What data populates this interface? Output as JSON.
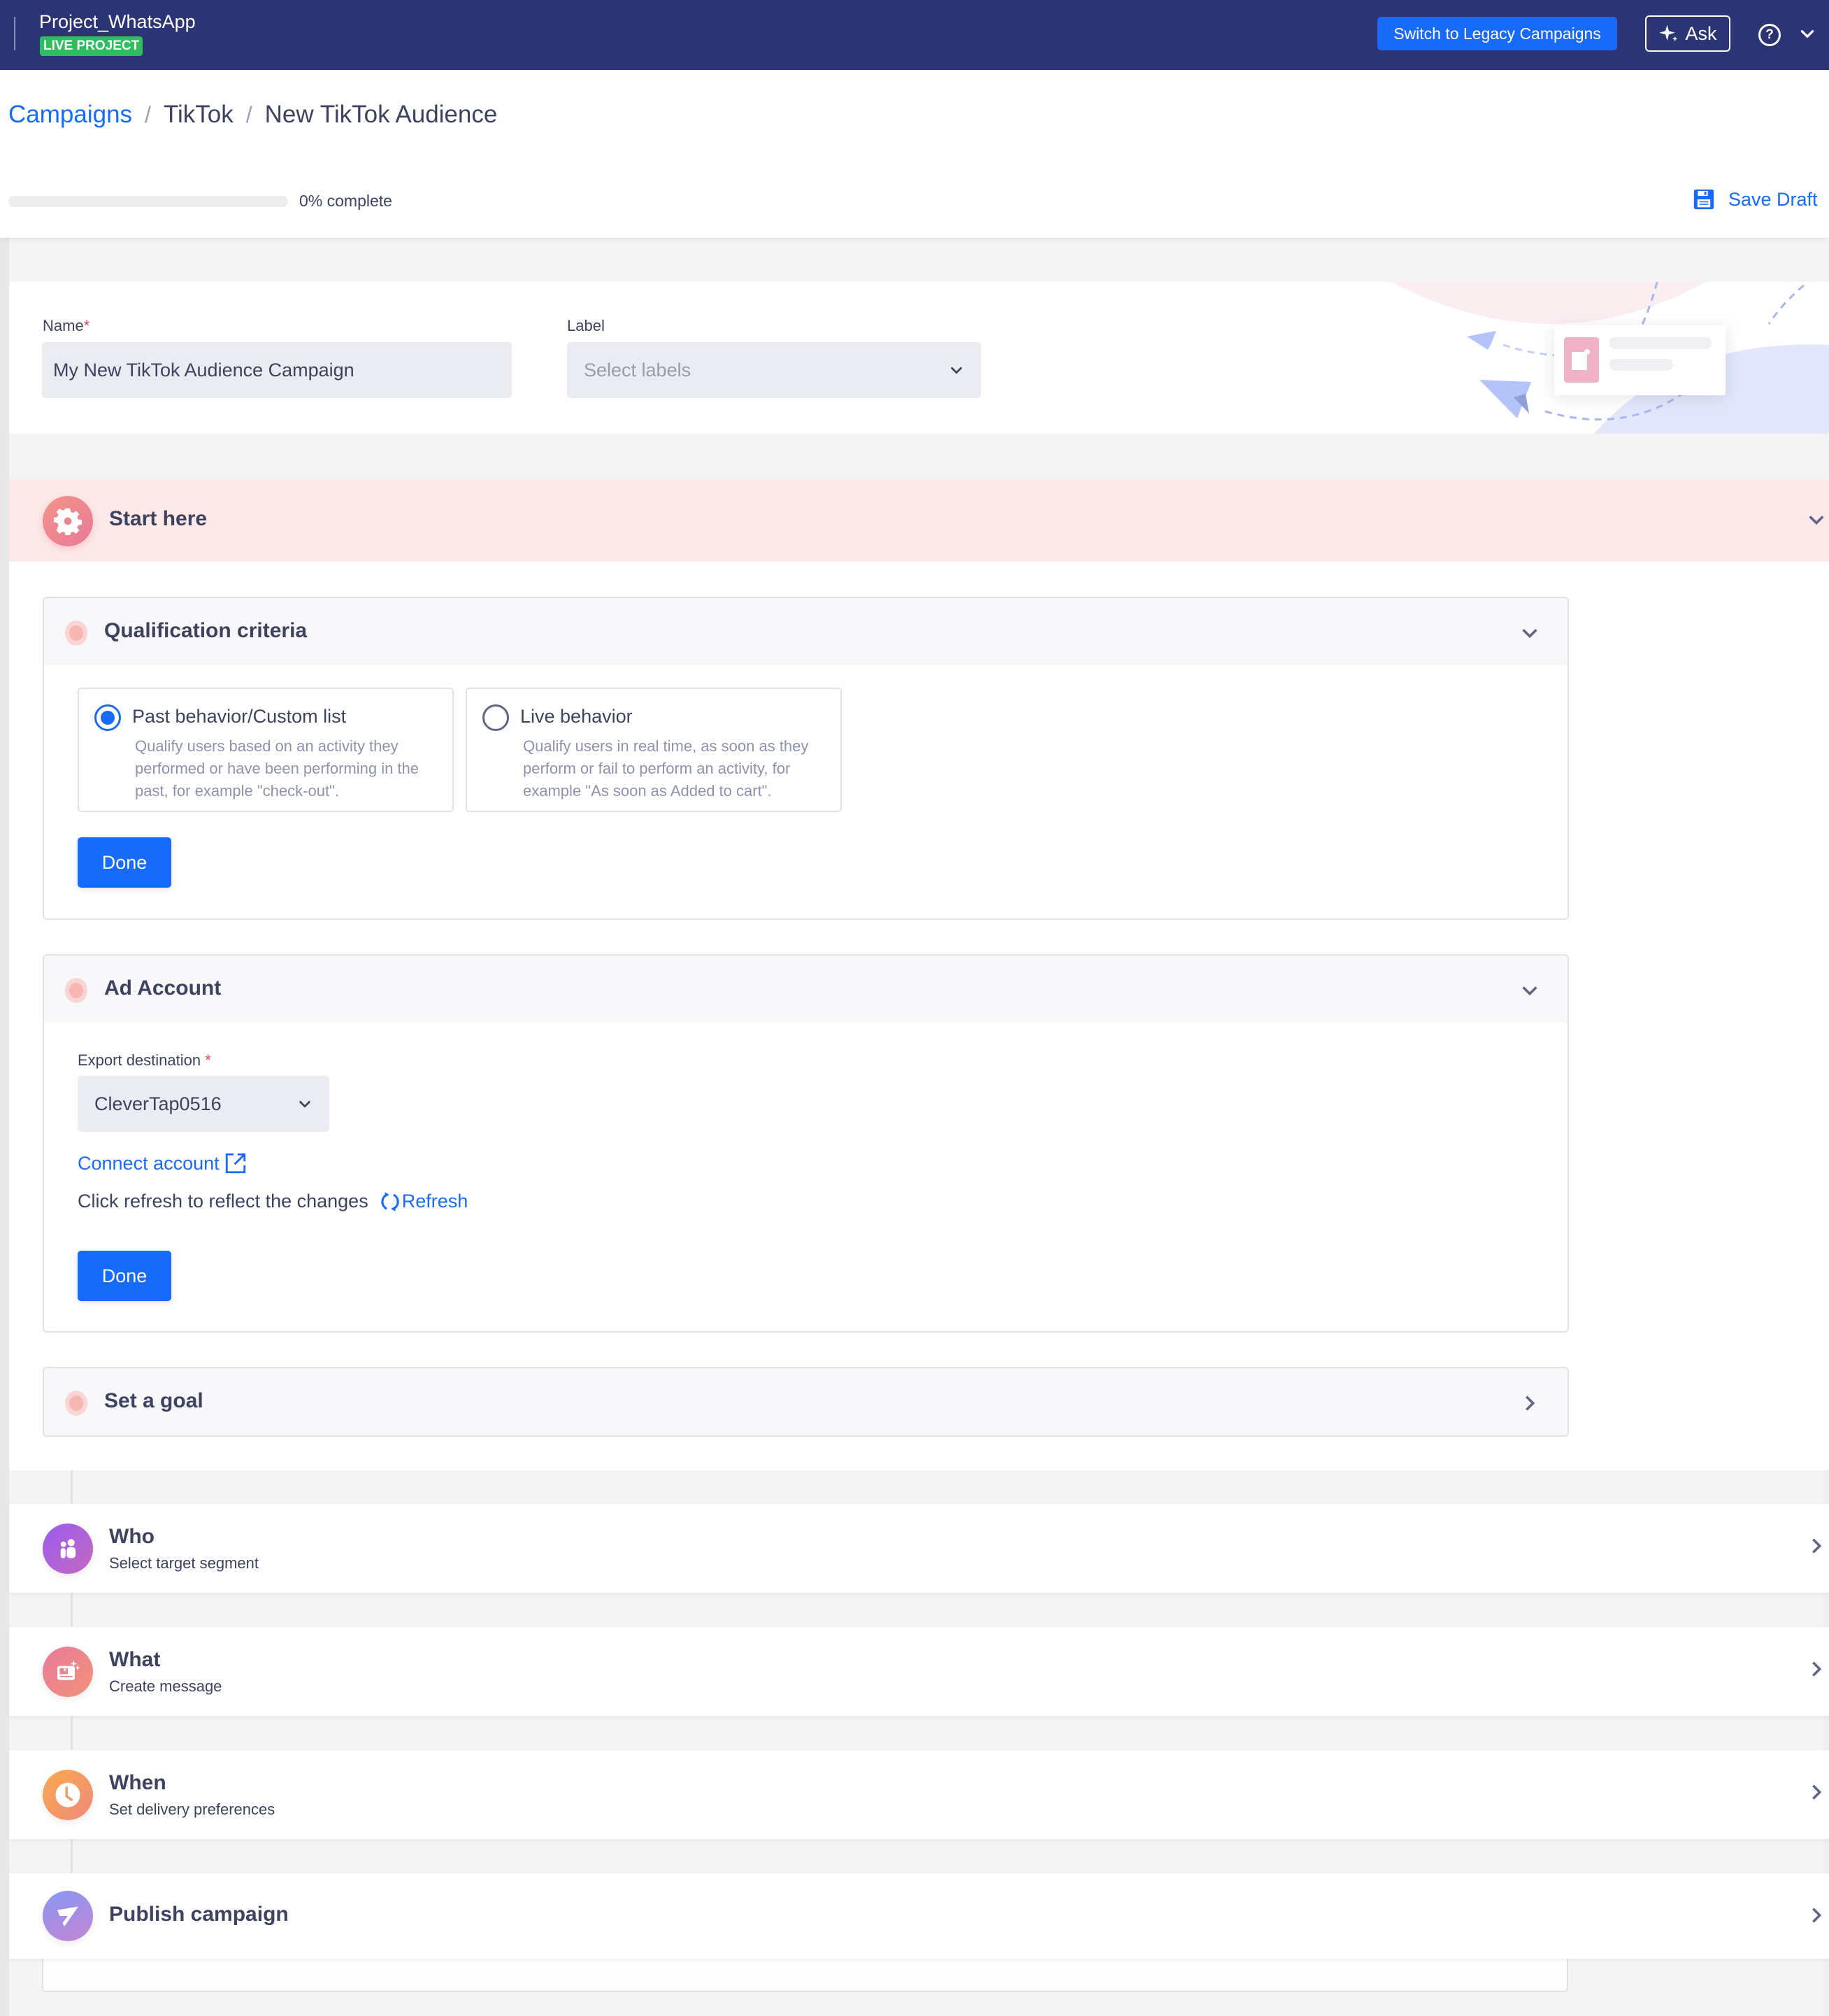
{
  "topbar": {
    "project_name": "Project_WhatsApp",
    "project_badge": "LIVE PROJECT",
    "legacy_button": "Switch to Legacy Campaigns",
    "ask_button": "Ask",
    "help_icon": "?",
    "colors": {
      "bar": "#2b3475",
      "badge": "#2ebd5f",
      "primary": "#176bfb"
    }
  },
  "breadcrumb": {
    "items": [
      "Campaigns",
      "TikTok",
      "New TikTok Audience"
    ],
    "separator": "/"
  },
  "progress": {
    "percent": 0,
    "label": "0% complete"
  },
  "save_draft": "Save Draft",
  "name_field": {
    "label": "Name",
    "required_mark": "*",
    "value": "My New TikTok Audience Campaign"
  },
  "label_field": {
    "label": "Label",
    "placeholder": "Select labels"
  },
  "start_here": {
    "title": "Start here",
    "qualification": {
      "title": "Qualification criteria",
      "options": [
        {
          "title": "Past behavior/Custom list",
          "description": "Qualify users based on an activity they performed or have been performing in the past, for example \"check-out\".",
          "selected": true
        },
        {
          "title": "Live behavior",
          "description": "Qualify users in real time, as soon as they perform or fail to perform an activity, for example \"As soon as Added to cart\".",
          "selected": false
        }
      ],
      "done_button": "Done"
    },
    "ad_account": {
      "title": "Ad Account",
      "export_label": "Export destination",
      "required_mark": "*",
      "export_value": "CleverTap0516",
      "connect_link": "Connect account",
      "refresh_hint": "Click refresh to reflect the changes",
      "refresh_link": "Refresh",
      "done_button": "Done"
    },
    "goal": {
      "title": "Set a goal"
    }
  },
  "steps": [
    {
      "title": "Who",
      "subtitle": "Select target segment",
      "icon": "people-icon"
    },
    {
      "title": "What",
      "subtitle": "Create message",
      "icon": "message-image-icon"
    },
    {
      "title": "When",
      "subtitle": "Set delivery preferences",
      "icon": "clock-icon"
    },
    {
      "title": "Publish campaign",
      "subtitle": "",
      "icon": "paper-plane-icon"
    }
  ]
}
